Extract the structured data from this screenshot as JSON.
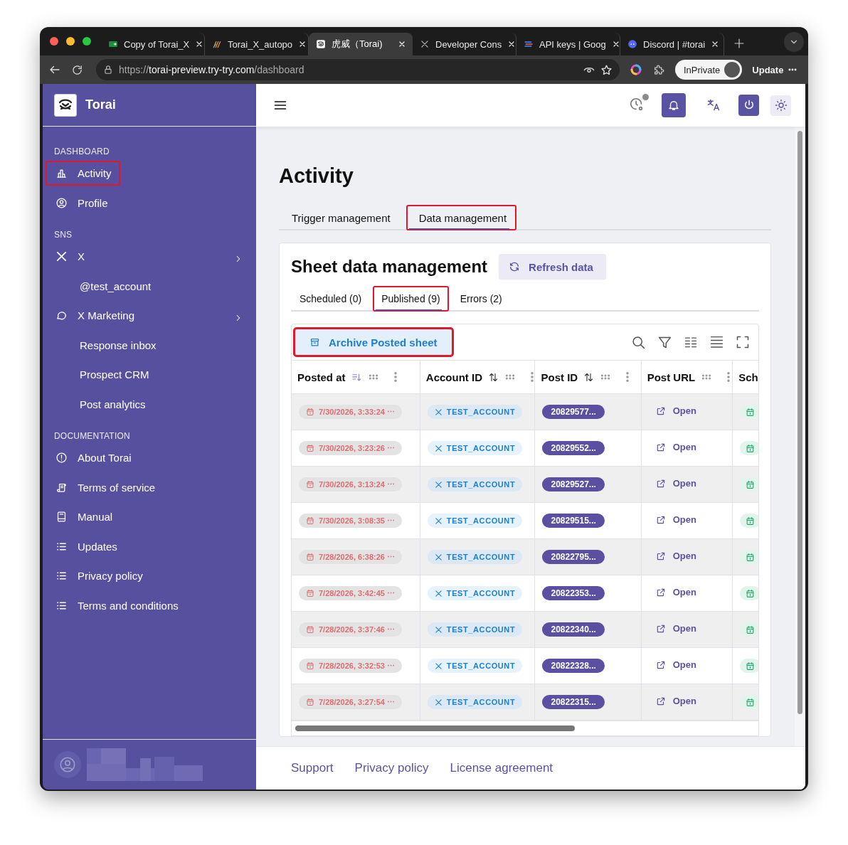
{
  "browser": {
    "tabs": [
      {
        "title": "Copy of Torai_X",
        "kind": "sheet",
        "selected": false
      },
      {
        "title": "Torai_X_autopo",
        "kind": "spark",
        "selected": false
      },
      {
        "title": "虎威（Torai)",
        "kind": "tiger",
        "selected": true
      },
      {
        "title": "Developer Cons",
        "kind": "x",
        "selected": false
      },
      {
        "title": "API keys | Goog",
        "kind": "stack",
        "selected": false
      },
      {
        "title": "Discord | #torai",
        "kind": "discord",
        "selected": false
      }
    ],
    "url_scheme": "https://",
    "url_host": "torai-preview.try-try.com",
    "url_path": "/dashboard",
    "profile_label": "InPrivate",
    "update_label": "Update"
  },
  "sidebar": {
    "brand": "Torai",
    "sections": [
      {
        "heading": "DASHBOARD",
        "items": [
          {
            "label": "Activity",
            "kind": "chart",
            "expandable": false,
            "highlighted": true
          },
          {
            "label": "Profile",
            "kind": "profile",
            "expandable": false,
            "highlighted": false
          }
        ]
      },
      {
        "heading": "SNS",
        "items": [
          {
            "label": "X",
            "kind": "x",
            "expandable": true,
            "highlighted": false
          },
          {
            "label": "@test_account",
            "kind": "sub",
            "expandable": false,
            "highlighted": false
          },
          {
            "label": "X Marketing",
            "kind": "chat",
            "expandable": true,
            "highlighted": false
          },
          {
            "label": "Response inbox",
            "kind": "sub",
            "expandable": false,
            "highlighted": false
          },
          {
            "label": "Prospect CRM",
            "kind": "sub",
            "expandable": false,
            "highlighted": false
          },
          {
            "label": "Post analytics",
            "kind": "sub",
            "expandable": false,
            "highlighted": false
          }
        ]
      },
      {
        "heading": "DOCUMENTATION",
        "items": [
          {
            "label": "About Torai",
            "kind": "info",
            "expandable": false,
            "highlighted": false
          },
          {
            "label": "Terms of service",
            "kind": "doc",
            "expandable": false,
            "highlighted": false
          },
          {
            "label": "Manual",
            "kind": "book",
            "expandable": false,
            "highlighted": false
          },
          {
            "label": "Updates",
            "kind": "list",
            "expandable": false,
            "highlighted": false
          },
          {
            "label": "Privacy policy",
            "kind": "list",
            "expandable": false,
            "highlighted": false
          },
          {
            "label": "Terms and conditions",
            "kind": "list",
            "expandable": false,
            "highlighted": false
          }
        ]
      }
    ]
  },
  "main": {
    "title": "Activity",
    "tabs": [
      {
        "label": "Trigger management",
        "selected": false,
        "highlighted": false
      },
      {
        "label": "Data management",
        "selected": true,
        "highlighted": true
      }
    ],
    "card": {
      "title": "Sheet data management",
      "refresh_label": "Refresh data",
      "tabs": [
        {
          "label": "Scheduled (0)",
          "selected": false,
          "highlighted": false
        },
        {
          "label": "Published (9)",
          "selected": true,
          "highlighted": true
        },
        {
          "label": "Errors (2)",
          "selected": false,
          "highlighted": false
        }
      ],
      "archive": {
        "label": "Archive Posted sheet",
        "highlighted": true
      },
      "columns": [
        {
          "label": "Posted at",
          "sortable": true,
          "sorted": true
        },
        {
          "label": "Account ID",
          "sortable": true,
          "sorted": false
        },
        {
          "label": "Post ID",
          "sortable": true,
          "sorted": false
        },
        {
          "label": "Post URL",
          "sortable": false,
          "sorted": false
        },
        {
          "label": "Sch"
        }
      ],
      "rows": [
        {
          "posted_at": "7/30/2026, 3:33:24 ⋯",
          "account": "TEST_ACCOUNT",
          "post_id": "20829577...",
          "link": "Open"
        },
        {
          "posted_at": "7/30/2026, 3:23:26 ⋯",
          "account": "TEST_ACCOUNT",
          "post_id": "20829552...",
          "link": "Open"
        },
        {
          "posted_at": "7/30/2026, 3:13:24 ⋯",
          "account": "TEST_ACCOUNT",
          "post_id": "20829527...",
          "link": "Open"
        },
        {
          "posted_at": "7/30/2026, 3:08:35 ⋯",
          "account": "TEST_ACCOUNT",
          "post_id": "20829515...",
          "link": "Open"
        },
        {
          "posted_at": "7/28/2026, 6:38:26 ⋯",
          "account": "TEST_ACCOUNT",
          "post_id": "20822795...",
          "link": "Open"
        },
        {
          "posted_at": "7/28/2026, 3:42:45 ⋯",
          "account": "TEST_ACCOUNT",
          "post_id": "20822353...",
          "link": "Open"
        },
        {
          "posted_at": "7/28/2026, 3:37:46 ⋯",
          "account": "TEST_ACCOUNT",
          "post_id": "20822340...",
          "link": "Open"
        },
        {
          "posted_at": "7/28/2026, 3:32:53 ⋯",
          "account": "TEST_ACCOUNT",
          "post_id": "20822328...",
          "link": "Open"
        },
        {
          "posted_at": "7/28/2026, 3:27:54 ⋯",
          "account": "TEST_ACCOUNT",
          "post_id": "20822315...",
          "link": "Open"
        }
      ]
    }
  },
  "footer": {
    "links": [
      "Support",
      "Privacy policy",
      "License agreement"
    ]
  }
}
